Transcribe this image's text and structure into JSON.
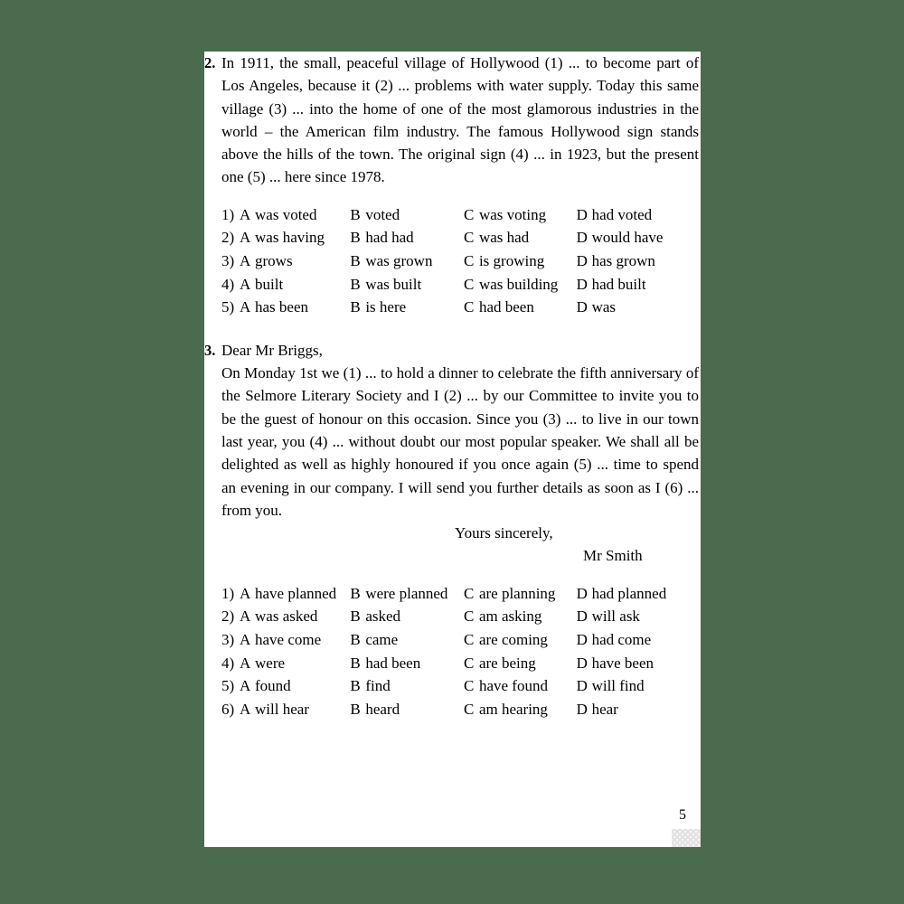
{
  "page": {
    "background_color": "#4a6b4d",
    "sheet_color": "#ffffff",
    "page_number": "5",
    "corner_swatch_color": "#e3e3e3"
  },
  "exercises": [
    {
      "number": "2.",
      "paragraph": "In 1911, the small, peaceful village of Hollywood (1) ... to become part of Los Angeles, because it (2) ... problems with water supply. Today this same village (3) ... into the home of one of the most glamorous industries in the world – the American film industry. The famous Hollywood sign stands above the hills of the town. The original sign (4) ... in 1923, but the present one (5) ... here since 1978.",
      "options": [
        {
          "index": "1)",
          "choices": [
            {
              "letter": "A",
              "text": "was voted"
            },
            {
              "letter": "B",
              "text": "voted"
            },
            {
              "letter": "C",
              "text": "was voting"
            },
            {
              "letter": "D",
              "text": "had voted"
            }
          ]
        },
        {
          "index": "2)",
          "choices": [
            {
              "letter": "A",
              "text": "was having"
            },
            {
              "letter": "B",
              "text": "had had"
            },
            {
              "letter": "C",
              "text": "was had"
            },
            {
              "letter": "D",
              "text": "would have"
            }
          ]
        },
        {
          "index": "3)",
          "choices": [
            {
              "letter": "A",
              "text": "grows"
            },
            {
              "letter": "B",
              "text": "was grown"
            },
            {
              "letter": "C",
              "text": "is growing"
            },
            {
              "letter": "D",
              "text": "has grown"
            }
          ]
        },
        {
          "index": "4)",
          "choices": [
            {
              "letter": "A",
              "text": "built"
            },
            {
              "letter": "B",
              "text": "was built"
            },
            {
              "letter": "C",
              "text": "was building"
            },
            {
              "letter": "D",
              "text": "had built"
            }
          ]
        },
        {
          "index": "5)",
          "choices": [
            {
              "letter": "A",
              "text": "has been"
            },
            {
              "letter": "B",
              "text": "is here"
            },
            {
              "letter": "C",
              "text": "had been"
            },
            {
              "letter": "D",
              "text": "was"
            }
          ]
        }
      ]
    },
    {
      "number": "3.",
      "salutation": "Dear Mr Briggs,",
      "paragraph": "On Monday 1st we (1) ... to hold a dinner to celebrate the fifth anniversary of the Selmore Literary Society and I (2) ... by our Committee to invite you to be the guest of honour on this occasion. Since you (3) ... to live in our town last year, you (4) ... without doubt our most popular speaker. We shall all be delighted as well as highly honoured if you once again (5) ... time to spend an evening in our company. I will send you further details as soon as I (6) ... from you.",
      "signoff": "Yours sincerely,",
      "signature": "Mr Smith",
      "options": [
        {
          "index": "1)",
          "choices": [
            {
              "letter": "A",
              "text": "have planned"
            },
            {
              "letter": "B",
              "text": "were planned"
            },
            {
              "letter": "C",
              "text": "are planning"
            },
            {
              "letter": "D",
              "text": "had planned"
            }
          ]
        },
        {
          "index": "2)",
          "choices": [
            {
              "letter": "A",
              "text": "was asked"
            },
            {
              "letter": "B",
              "text": "asked"
            },
            {
              "letter": "C",
              "text": "am asking"
            },
            {
              "letter": "D",
              "text": "will ask"
            }
          ]
        },
        {
          "index": "3)",
          "choices": [
            {
              "letter": "A",
              "text": "have come"
            },
            {
              "letter": "B",
              "text": "came"
            },
            {
              "letter": "C",
              "text": "are coming"
            },
            {
              "letter": "D",
              "text": "had come"
            }
          ]
        },
        {
          "index": "4)",
          "choices": [
            {
              "letter": "A",
              "text": "were"
            },
            {
              "letter": "B",
              "text": "had been"
            },
            {
              "letter": "C",
              "text": "are being"
            },
            {
              "letter": "D",
              "text": "have been"
            }
          ]
        },
        {
          "index": "5)",
          "choices": [
            {
              "letter": "A",
              "text": "found"
            },
            {
              "letter": "B",
              "text": "find"
            },
            {
              "letter": "C",
              "text": "have found"
            },
            {
              "letter": "D",
              "text": "will find"
            }
          ]
        },
        {
          "index": "6)",
          "choices": [
            {
              "letter": "A",
              "text": "will hear"
            },
            {
              "letter": "B",
              "text": "heard"
            },
            {
              "letter": "C",
              "text": "am hearing"
            },
            {
              "letter": "D",
              "text": "hear"
            }
          ]
        }
      ]
    }
  ]
}
